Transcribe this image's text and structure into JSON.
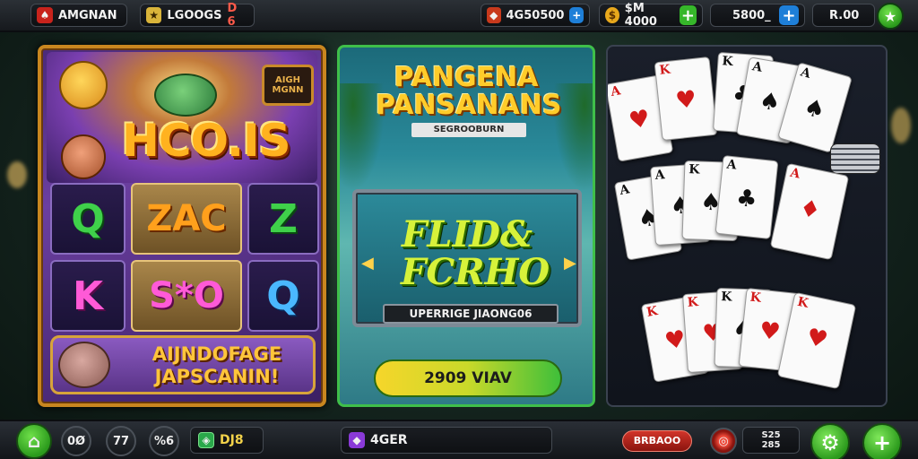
{
  "top_bar": {
    "account_label": "AMGNAN",
    "level_label": "LGOOGS",
    "level_value": "D 6",
    "gems": "4G50500",
    "coins": "$M 4000",
    "balance": "5800_",
    "score": "R.00",
    "icons": {
      "account": "card-icon",
      "level": "star-avatar-icon",
      "gems": "gem-icon",
      "coins": "coin-icon",
      "plus": "plus-icon",
      "star": "star-icon"
    }
  },
  "slot_game": {
    "title": "HCO.IS",
    "sign": "AIGH\nMGNN",
    "reels": [
      {
        "symbol": "Q",
        "color": "#3fd14a"
      },
      {
        "symbol": "ZAC",
        "color": "#ffa01c"
      },
      {
        "symbol": "Z",
        "color": "#3fd14a"
      },
      {
        "symbol": "K",
        "color": "#ff5ad7"
      },
      {
        "symbol": "S*O",
        "color": "#ff5ad7"
      },
      {
        "symbol": "Q",
        "color": "#4ab8ff"
      }
    ],
    "bonus_text": "AIJNDOFAGE JAPSCANIN!"
  },
  "lagoon_game": {
    "title": "PANGENA PANSANANS",
    "subtitle": "SEGROOBURN",
    "frame_title": "FLID& FCRHO",
    "frame_caption": "UPERRIGE JIAONG06",
    "play_label": "2909 VIAV"
  },
  "card_game": {
    "top_row": [
      {
        "rank": "A",
        "suit": "♥",
        "color": "red"
      },
      {
        "rank": "K",
        "suit": "♥",
        "color": "red"
      },
      {
        "rank": "K",
        "suit": "♣",
        "color": "black"
      },
      {
        "rank": "A",
        "suit": "♠",
        "color": "black"
      },
      {
        "rank": "A",
        "suit": "♠",
        "color": "black"
      }
    ],
    "middle_row": [
      {
        "rank": "A",
        "suit": "♠",
        "color": "black"
      },
      {
        "rank": "A",
        "suit": "♠",
        "color": "black"
      },
      {
        "rank": "K",
        "suit": "♠",
        "color": "black"
      },
      {
        "rank": "A",
        "suit": "♣",
        "color": "black"
      },
      {
        "rank": "A",
        "suit": "♦",
        "color": "red"
      }
    ],
    "bottom_row": [
      {
        "rank": "K",
        "suit": "♥",
        "color": "red"
      },
      {
        "rank": "K",
        "suit": "♥",
        "color": "red"
      },
      {
        "rank": "K",
        "suit": "♠",
        "color": "black"
      },
      {
        "rank": "K",
        "suit": "♥",
        "color": "red"
      },
      {
        "rank": "K",
        "suit": "♥",
        "color": "red"
      }
    ]
  },
  "bottom_bar": {
    "btn1": "0Ø",
    "btn2": "77",
    "btn3": "%6",
    "shield_value": "DJ8",
    "search_text": "4GER",
    "red_pill": "BRBAOO",
    "counter": "S25\n285",
    "icons": {
      "home": "home-icon",
      "shield": "shield-icon",
      "gem": "purple-gem-icon",
      "target": "target-icon",
      "settings": "gear-icon",
      "add": "plus-icon"
    }
  },
  "colors": {
    "accent_green": "#3fbf3a",
    "gold_border": "#c9861f",
    "topbar_bg": "#1a1d22"
  }
}
